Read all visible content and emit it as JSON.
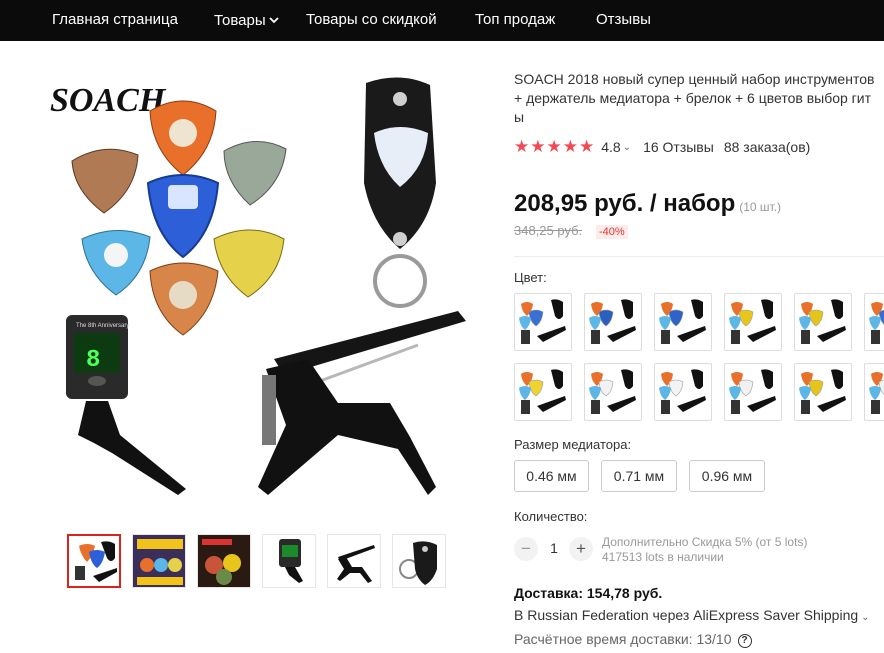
{
  "nav": {
    "home": "Главная страница",
    "products": "Товары",
    "discounted": "Товары со скидкой",
    "top_sales": "Топ продаж",
    "reviews": "Отзывы"
  },
  "gallery": {
    "brand_logo": "SOACH",
    "tuner_caption": "The 8th Anniversary",
    "tuner_display": "8",
    "thumbnails": [
      {
        "icon": "product-set-image"
      },
      {
        "icon": "picks-banner-image"
      },
      {
        "icon": "picks-collection-image"
      },
      {
        "icon": "tuner-image"
      },
      {
        "icon": "capo-image"
      },
      {
        "icon": "pick-holder-image"
      }
    ]
  },
  "product": {
    "title": "SOACH 2018 новый супер ценный набор инструментов\n+ держатель медиатора + брелок + 6 цветов выбор гит\nы",
    "stars": "★★★★★",
    "rating": "4.8",
    "reviews": "16 Отзывы",
    "orders": "88 заказа(ов)",
    "price": "208,95 руб. / набор",
    "price_unit": "(10 шт.)",
    "old_price": "348,25 руб.",
    "discount": "-40%",
    "accent_color": "#f04b54"
  },
  "options": {
    "color_label": "Цвет:",
    "color_variants": [
      {
        "accent": "#3b6fd4"
      },
      {
        "accent": "#2b5fbf"
      },
      {
        "accent": "#2f63c8"
      },
      {
        "accent": "#e8c51b"
      },
      {
        "accent": "#e6c41a"
      },
      {
        "accent": "#3a6cd0"
      },
      {
        "accent": "#f0d230"
      },
      {
        "accent": "#f2f2f2"
      },
      {
        "accent": "#f3f3f3"
      },
      {
        "accent": "#f1f1f1"
      },
      {
        "accent": "#e6c41a"
      },
      {
        "accent": "#f2f2f2"
      }
    ],
    "size_label": "Размер медиатора:",
    "sizes": [
      "0.46 мм",
      "0.71 мм",
      "0.96 мм"
    ]
  },
  "quantity": {
    "label": "Количество:",
    "minus": "−",
    "plus": "+",
    "value": "1",
    "discount_note": "Дополнительно Скидка 5% (от 5 lots)",
    "stock": "417513 lots в наличии"
  },
  "shipping": {
    "price": "Доставка: 154,78 руб.",
    "route": "В Russian Federation через AliExpress Saver Shipping",
    "time": "Расчётное время доставки: 13/10",
    "help": "?"
  }
}
